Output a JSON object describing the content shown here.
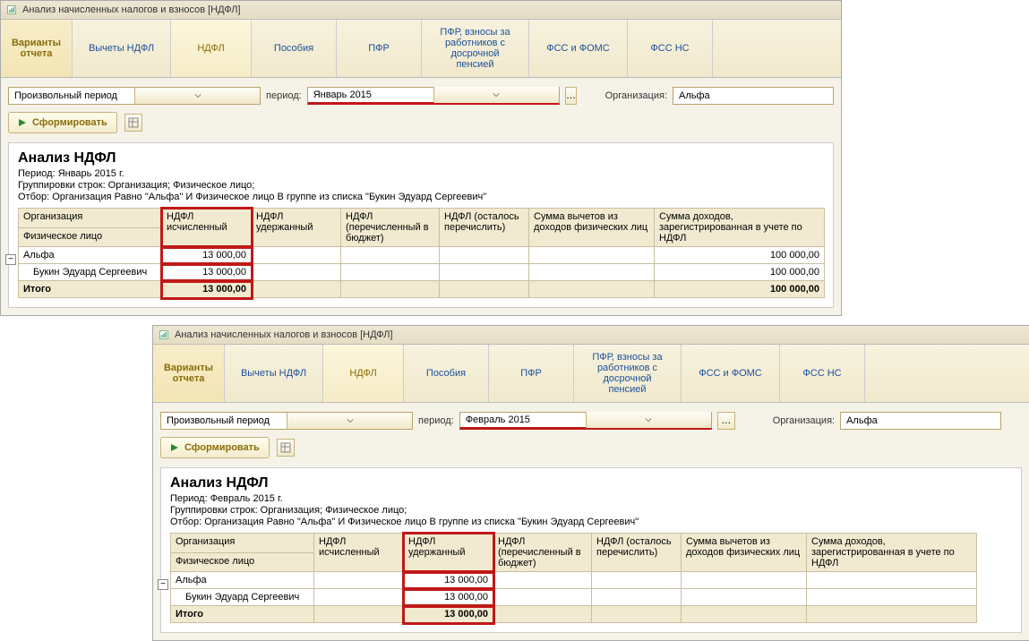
{
  "window1": {
    "title": "Анализ начисленных налогов и взносов [НДФЛ]",
    "tabs": {
      "variants": "Варианты отчета",
      "t0": "Вычеты НДФЛ",
      "t1": "НДФЛ",
      "t2": "Пособия",
      "t3": "ПФР",
      "t4": "ПФР, взносы за работников с досрочной пенсией",
      "t5": "ФСС и ФОМС",
      "t6": "ФСС НС"
    },
    "period_type": "Произвольный период",
    "period_label": "период:",
    "period_value": "Январь 2015",
    "org_label": "Организация:",
    "org_value": "Альфа",
    "generate": "Сформировать",
    "report": {
      "title": "Анализ НДФЛ",
      "line1": "Период: Январь 2015 г.",
      "line2": "Группировки строк: Организация; Физическое лицо;",
      "line3": "Отбор: Организация Равно \"Альфа\" И Физическое лицо В группе из списка \"Букин Эдуард Сергеевич\"",
      "headers": {
        "org": "Организация",
        "person": "Физическое лицо",
        "calc": "НДФЛ исчисленный",
        "withheld": "НДФЛ удержанный",
        "transferred": "НДФЛ (перечисленный в бюджет)",
        "remaining": "НДФЛ (осталось перечислить)",
        "deductions": "Сумма вычетов из доходов физических лиц",
        "income": "Сумма доходов, зарегистрированная в учете по НДФЛ"
      },
      "rows": {
        "r0": {
          "org": "Альфа",
          "calc": "13 000,00",
          "income": "100 000,00"
        },
        "r1": {
          "org": "Букин Эдуард Сергеевич",
          "calc": "13 000,00",
          "income": "100 000,00"
        },
        "total": {
          "org": "Итого",
          "calc": "13 000,00",
          "income": "100 000,00"
        }
      }
    }
  },
  "window2": {
    "title": "Анализ начисленных налогов и взносов [НДФЛ]",
    "tabs": {
      "variants": "Варианты отчета",
      "t0": "Вычеты НДФЛ",
      "t1": "НДФЛ",
      "t2": "Пособия",
      "t3": "ПФР",
      "t4": "ПФР, взносы за работников с досрочной пенсией",
      "t5": "ФСС и ФОМС",
      "t6": "ФСС НС"
    },
    "period_type": "Произвольный период",
    "period_label": "период:",
    "period_value": "Февраль 2015",
    "org_label": "Организация:",
    "org_value": "Альфа",
    "generate": "Сформировать",
    "report": {
      "title": "Анализ НДФЛ",
      "line1": "Период: Февраль 2015 г.",
      "line2": "Группировки строк: Организация; Физическое лицо;",
      "line3": "Отбор: Организация Равно \"Альфа\" И Физическое лицо В группе из списка \"Букин Эдуард Сергеевич\"",
      "headers": {
        "org": "Организация",
        "person": "Физическое лицо",
        "calc": "НДФЛ исчисленный",
        "withheld": "НДФЛ удержанный",
        "transferred": "НДФЛ (перечисленный в бюджет)",
        "remaining": "НДФЛ (осталось перечислить)",
        "deductions": "Сумма вычетов из доходов физических лиц",
        "income": "Сумма доходов, зарегистрированная в учете по НДФЛ"
      },
      "rows": {
        "r0": {
          "org": "Альфа",
          "withheld": "13 000,00"
        },
        "r1": {
          "org": "Букин Эдуард Сергеевич",
          "withheld": "13 000,00"
        },
        "total": {
          "org": "Итого",
          "withheld": "13 000,00"
        }
      }
    }
  }
}
